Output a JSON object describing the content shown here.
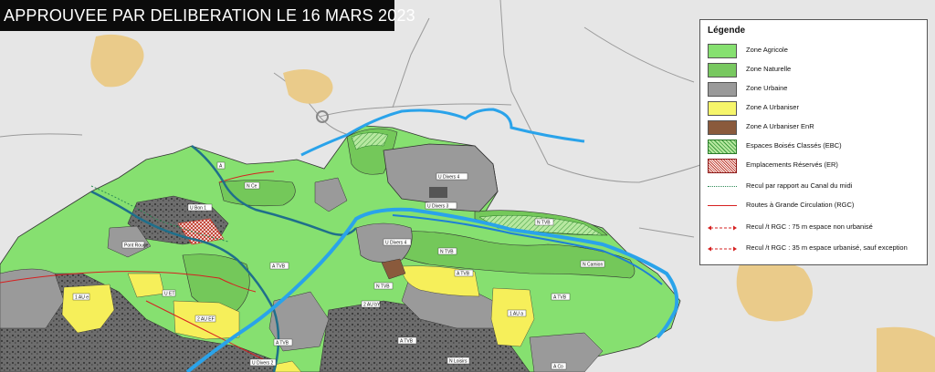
{
  "title": "APPROUVEE PAR DELIBERATION LE 16 MARS 2023",
  "legend": {
    "title": "Légende",
    "items": [
      {
        "label": "Zone Agricole",
        "color": "#86e070",
        "kind": "swatch"
      },
      {
        "label": "Zone Naturelle",
        "color": "#78c860",
        "kind": "swatch"
      },
      {
        "label": "Zone Urbaine",
        "color": "#9a9a9a",
        "kind": "swatch"
      },
      {
        "label": "Zone A Urbaniser",
        "color": "#f6f56a",
        "kind": "swatch"
      },
      {
        "label": "Zone A Urbaniser EnR",
        "color": "#8a5a3c",
        "kind": "swatch"
      },
      {
        "label": "Espaces Boisés Classés (EBC)",
        "color": "#b7e8a0",
        "kind": "hatch-green"
      },
      {
        "label": "Emplacements Réservés (ER)",
        "color": "#c0392b",
        "kind": "hatch-red"
      },
      {
        "label": "Recul par rapport au Canal du midi",
        "color": "#2e8b57",
        "kind": "dotted"
      },
      {
        "label": "Routes à Grande Circulation (RGC)",
        "color": "#d62020",
        "kind": "line"
      },
      {
        "label": "Recul /t RGC : 75 m espace non urbanisé",
        "color": "#d62020",
        "kind": "arrow"
      },
      {
        "label": "Recul /t RGC : 35 m espace urbanisé, sauf exception",
        "color": "#d62020",
        "kind": "arrow"
      }
    ]
  },
  "zone_labels": [
    {
      "text": "U Divers 4"
    },
    {
      "text": "U Divers 3"
    },
    {
      "text": "U Bon 1"
    },
    {
      "text": "N Ce"
    },
    {
      "text": "A"
    },
    {
      "text": "Pont Rouge"
    },
    {
      "text": "A TVB"
    },
    {
      "text": "U Divers 4"
    },
    {
      "text": "N TVB"
    },
    {
      "text": "N TVB"
    },
    {
      "text": "A TVB"
    },
    {
      "text": "N Camion"
    },
    {
      "text": "A TVB"
    },
    {
      "text": "1 AU a"
    },
    {
      "text": "2 AU EF"
    },
    {
      "text": "1 AU e"
    },
    {
      "text": "U ET"
    },
    {
      "text": "2 AU bY"
    },
    {
      "text": "N Loisirs"
    },
    {
      "text": "A TVB"
    },
    {
      "text": "U Divers 2"
    },
    {
      "text": "A Co"
    },
    {
      "text": "A TVB"
    },
    {
      "text": "N TVB"
    }
  ]
}
